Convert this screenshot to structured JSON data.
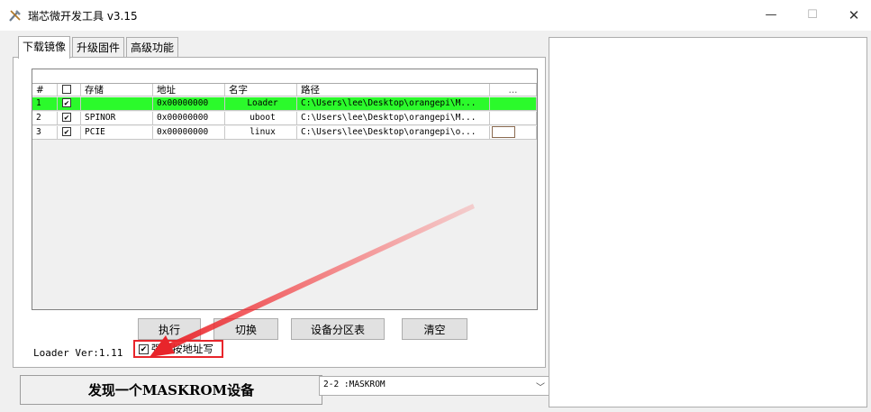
{
  "window": {
    "title": "瑞芯微开发工具 v3.15",
    "min": "—",
    "max": "☐",
    "close": "✕"
  },
  "tabs": [
    "下载镜像",
    "升级固件",
    "高级功能"
  ],
  "grid": {
    "headers": [
      "#",
      "",
      "存储",
      "地址",
      "名字",
      "路径",
      "..."
    ],
    "rows": [
      {
        "num": "1",
        "checked": "✔",
        "storage": "",
        "address": "0x00000000",
        "name": "Loader",
        "path": "C:\\Users\\lee\\Desktop\\orangepi\\M...",
        "selected": true
      },
      {
        "num": "2",
        "checked": "✔",
        "storage": "SPINOR",
        "address": "0x00000000",
        "name": "uboot",
        "path": "C:\\Users\\lee\\Desktop\\orangepi\\M..."
      },
      {
        "num": "3",
        "checked": "✔",
        "storage": "PCIE",
        "address": "0x00000000",
        "name": "linux",
        "path": "C:\\Users\\lee\\Desktop\\orangepi\\o..."
      }
    ]
  },
  "loader_version": "Loader Ver:1.11",
  "buttons": {
    "execute": "执行",
    "switch": "切换",
    "partition": "设备分区表",
    "clear": "清空"
  },
  "force_write": {
    "label": "强制按地址写",
    "checked": "✔"
  },
  "status": {
    "message": "发现一个MASKROM设备",
    "device": "2-2 :MASKROM",
    "caret": "﹀"
  },
  "colors": {
    "selected_row": "#2bfa2b",
    "highlight": "#e8252b"
  },
  "icons": {
    "app": "tools-icon"
  }
}
